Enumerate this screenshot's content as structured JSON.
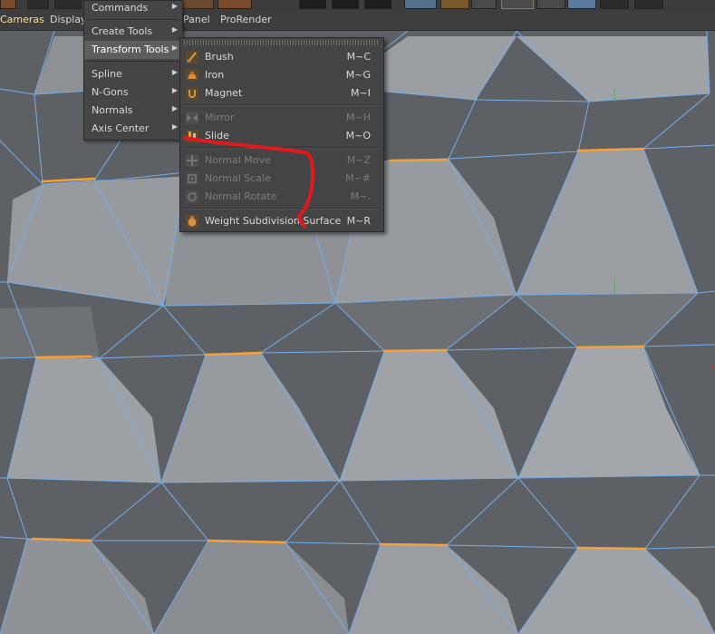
{
  "menubar": {
    "items": [
      "Cameras",
      "Display",
      "Panel",
      "ProRender"
    ]
  },
  "submenu": {
    "items": [
      {
        "label": "Commands"
      },
      {
        "label": "Create Tools"
      },
      {
        "label": "Transform Tools"
      },
      {
        "label": "Spline"
      },
      {
        "label": "N-Gons"
      },
      {
        "label": "Normals"
      },
      {
        "label": "Axis Center"
      }
    ],
    "arrow": "▶"
  },
  "transform_menu": {
    "items": [
      {
        "label": "Brush",
        "shortcut": "M~C",
        "icon": "brush-icon",
        "enabled": true
      },
      {
        "label": "Iron",
        "shortcut": "M~G",
        "icon": "iron-icon",
        "enabled": true
      },
      {
        "label": "Magnet",
        "shortcut": "M~I",
        "icon": "magnet-icon",
        "enabled": true
      },
      {
        "label": "Mirror",
        "shortcut": "M~H",
        "icon": "mirror-icon",
        "enabled": false
      },
      {
        "label": "Slide",
        "shortcut": "M~O",
        "icon": "slide-icon",
        "enabled": true
      },
      {
        "label": "Normal Move",
        "shortcut": "M~Z",
        "icon": "normal-move-icon",
        "enabled": false
      },
      {
        "label": "Normal Scale",
        "shortcut": "M~#",
        "icon": "normal-scale-icon",
        "enabled": false
      },
      {
        "label": "Normal Rotate",
        "shortcut": "M~.",
        "icon": "normal-rotate-icon",
        "enabled": false
      },
      {
        "label": "Weight Subdivision Surface",
        "shortcut": "M~R",
        "icon": "weight-subdivision-icon",
        "enabled": true
      }
    ]
  },
  "colors": {
    "menu_bg": "#444444",
    "highlight": "#5e5e5e",
    "active_menu_text": "#f6e08a",
    "mesh_edge": "#78aee8",
    "selected_edge": "#f7a035",
    "annotation": "#e0191e"
  }
}
